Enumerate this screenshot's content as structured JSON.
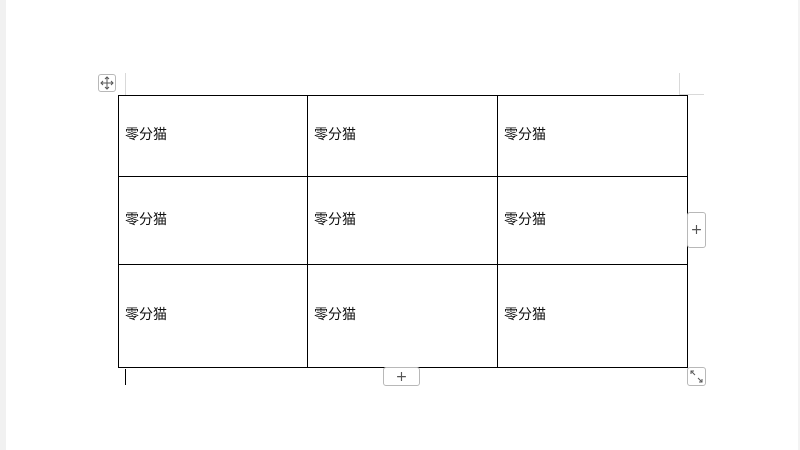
{
  "table": {
    "rows": [
      {
        "cells": [
          "零分猫",
          "零分猫",
          "零分猫"
        ]
      },
      {
        "cells": [
          "零分猫",
          "零分猫",
          "零分猫"
        ]
      },
      {
        "cells": [
          "零分猫",
          "零分猫",
          "零分猫"
        ]
      }
    ]
  },
  "controls": {
    "add_column_symbol": "+",
    "add_row_symbol": "+",
    "move_handle_icon": "move-arrows-icon",
    "resize_handle_icon": "diagonal-resize-icon"
  },
  "colors": {
    "table_border": "#000000",
    "control_border": "#b8b8b8",
    "guide_line": "#d9d9d9"
  }
}
